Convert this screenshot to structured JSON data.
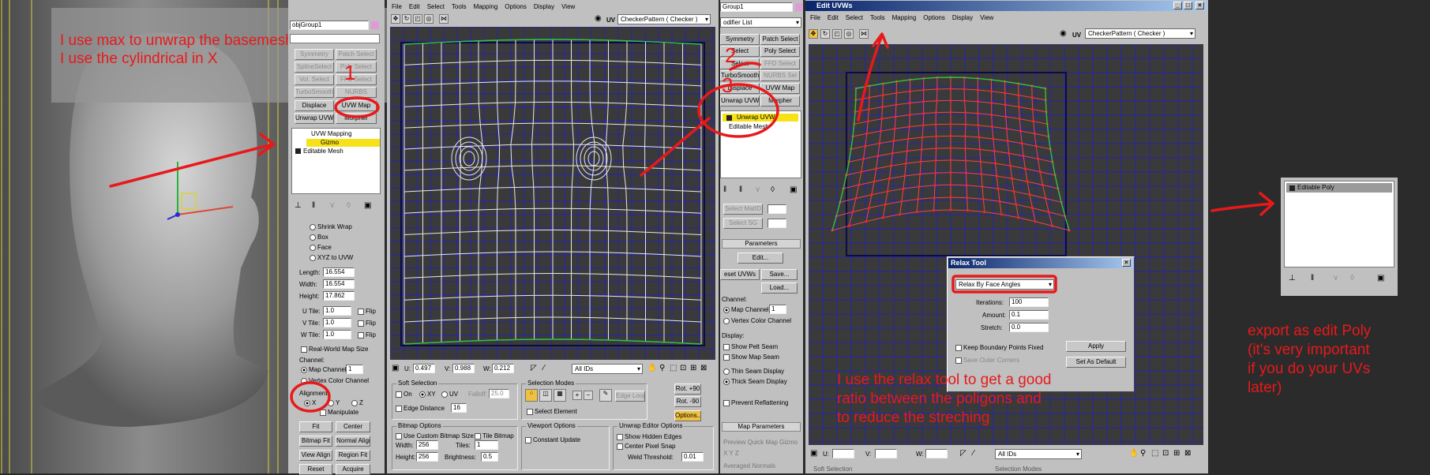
{
  "annotations": {
    "left_line1": "I use max to unwrap the basemesh",
    "left_line2": "I use the cylindrical in X",
    "relax_line1": "I use the relax tool to get a good",
    "relax_line2": "ratio between the poligons and",
    "relax_line3": "to reduce the streching",
    "export_line1": "export as edit Poly",
    "export_line2": "(it's very important",
    "export_line3": "if you do your UVs",
    "export_line4": "later)",
    "num1": "1",
    "num2": "2",
    "num3": "3"
  },
  "panel1": {
    "object_name": "objGroup1",
    "buttons": [
      "Symmetry",
      "Patch Select",
      "SplineSelect",
      "Poly Select",
      "Vol. Select",
      "FFD Select",
      "TurboSmooth",
      "NURBS",
      "Displace",
      "UVW Map",
      "Unwrap UVW",
      "Morpher"
    ],
    "stack": [
      "UVW Mapping",
      "Gizmo",
      "Editable Mesh"
    ],
    "mapping_options": [
      "Shrink Wrap",
      "Box",
      "Face",
      "XYZ to UVW"
    ],
    "length_label": "Length:",
    "length": "16.554",
    "width_label": "Width:",
    "width": "16.554",
    "height_label": "Height:",
    "height": "17.862",
    "utile_label": "U Tile:",
    "utile": "1.0",
    "vtile_label": "V Tile:",
    "vtile": "1.0",
    "wtile_label": "W Tile:",
    "wtile": "1.0",
    "flip": "Flip",
    "real_world": "Real-World Map Size",
    "channel_title": "Channel:",
    "map_channel": "Map Channel:",
    "map_channel_value": "1",
    "vertex_color_channel": "Vertex Color Channel",
    "alignment_title": "Alignment:",
    "axis_x": "X",
    "axis_y": "Y",
    "axis_z": "Z",
    "manipulate": "Manipulate",
    "fit": "Fit",
    "center": "Center",
    "bitmap_fit": "Bitmap Fit",
    "normal_align": "Normal Align",
    "view_align": "View Align",
    "region_fit": "Region Fit",
    "reset": "Reset",
    "acquire": "Acquire"
  },
  "uv_editor1": {
    "menu": [
      "File",
      "Edit",
      "Select",
      "Tools",
      "Mapping",
      "Options",
      "Display",
      "View"
    ],
    "uv_label": "UV",
    "checker": "CheckerPattern  ( Checker )",
    "u_label": "U:",
    "u": "0.497",
    "v_label": "V:",
    "v": "0.988",
    "w_label": "W:",
    "w": "0.212",
    "ids": "All IDs",
    "soft_selection": "Soft Selection",
    "on": "On",
    "xy": "XY",
    "uv": "UV",
    "falloff_label": "Falloff:",
    "falloff": "25.0",
    "edge_distance": "Edge Distance",
    "edge_distance_value": "16",
    "selection_modes": "Selection Modes",
    "edge_loop": "Edge Loop",
    "select_element": "Select Element",
    "rot_p90": "Rot. +90",
    "rot_m90": "Rot. -90",
    "options": "Options...",
    "bitmap_options": "Bitmap Options",
    "use_custom": "Use Custom Bitmap Size",
    "tile_bitmap": "Tile Bitmap",
    "width_label": "Width:",
    "width": "256",
    "height_label": "Height:",
    "height": "256",
    "tiles_label": "Tiles:",
    "tiles": "1",
    "brightness_label": "Brightness:",
    "brightness": "0.5",
    "viewport_options": "Viewport Options",
    "constant_update": "Constant Update",
    "unwrap_editor_options": "Unwrap Editor Options",
    "show_hidden_edges": "Show Hidden Edges",
    "center_pixel_snap": "Center Pixel Snap",
    "weld_threshold_label": "Weld Threshold:",
    "weld_threshold": "0.01"
  },
  "panel2": {
    "object_name": "Group1",
    "modifier_list": "odifier List",
    "buttons": [
      "Symmetry",
      "Patch Select",
      "Select",
      "Poly Select",
      "Select",
      "FFD Select",
      "TurboSmooth",
      "NURBS Sel",
      "Displace",
      "UVW Map",
      "Unwrap UVW",
      "Morpher"
    ],
    "stack": [
      "Unwrap UVW",
      "Editable Mesh"
    ],
    "select_mmid": "Select MatID",
    "select_sg": "Select SG",
    "parameters": "Parameters",
    "edit": "Edit...",
    "reset_uvws": "eset UVWs",
    "save": "Save...",
    "load": "Load...",
    "channel": "Channel:",
    "map_channel": "Map Channel:",
    "map_channel_value": "1",
    "vertex_color_channel": "Vertex Color Channel",
    "display": "Display:",
    "show_pelt_seam": "Show Pelt Seam",
    "show_map_seam": "Show Map Seam",
    "thin_seam": "Thin Seam Display",
    "thick_seam": "Thick Seam Display",
    "prevent_reflattening": "Prevent Reflattening",
    "map_parameters": "Map Parameters",
    "preview_quick": "Preview Quick Map Gizmo",
    "xyz": "X  Y  Z",
    "averaged_normals": "Averaged Normals"
  },
  "uv_editor2": {
    "title": "Edit UVWs",
    "menu": [
      "File",
      "Edit",
      "Select",
      "Tools",
      "Mapping",
      "Options",
      "Display",
      "View"
    ],
    "uv_label": "UV",
    "checker": "CheckerPattern  ( Checker )",
    "u_label": "U:",
    "v_label": "V:",
    "w_label": "W:",
    "ids": "All IDs",
    "footer_left": "Soft Selection",
    "footer_right": "Selection Modes"
  },
  "relax_tool": {
    "title": "Relax Tool",
    "mode": "Relax By Face Angles",
    "iterations_label": "Iterations:",
    "iterations": "100",
    "amount_label": "Amount:",
    "amount": "0.1",
    "stretch_label": "Stretch:",
    "stretch": "0.0",
    "keep_boundary": "Keep Boundary Points Fixed",
    "save_outer": "Save Outer Corners",
    "apply": "Apply",
    "set_default": "Set As Default"
  },
  "poly_panel": {
    "stack": [
      "Editable Poly"
    ]
  }
}
